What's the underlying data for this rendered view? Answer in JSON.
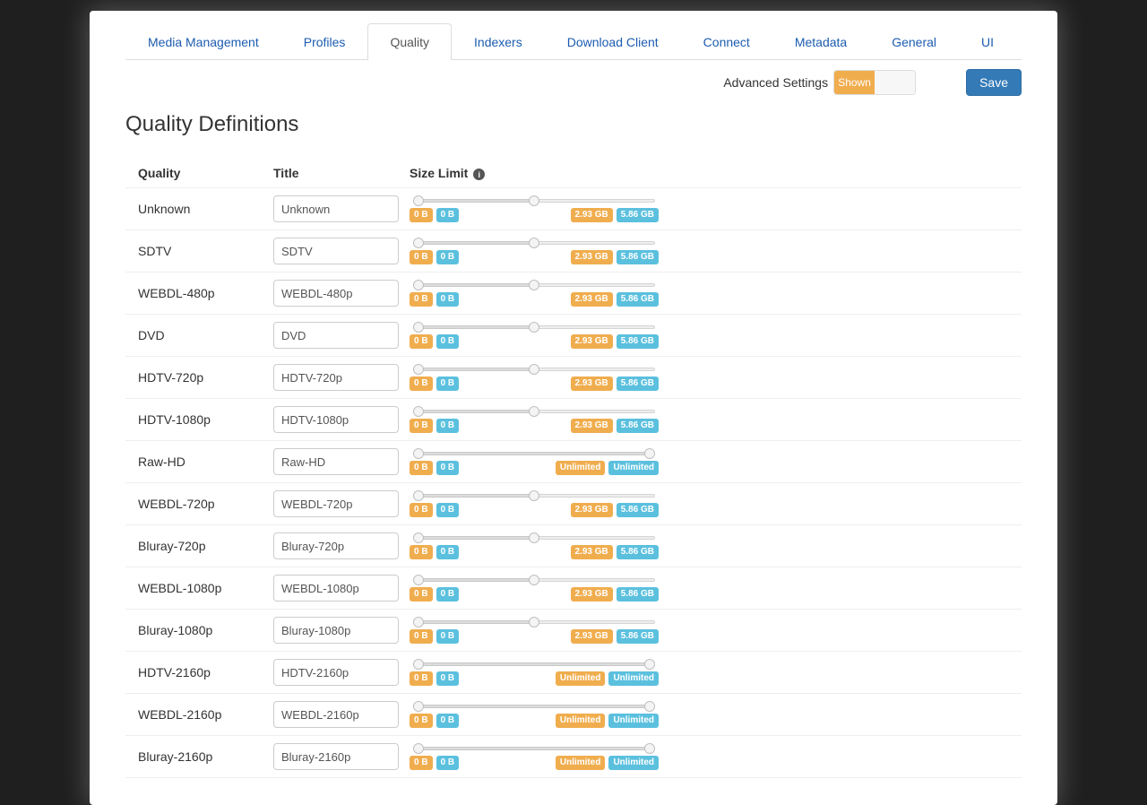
{
  "tabs": [
    {
      "label": "Media Management",
      "active": false
    },
    {
      "label": "Profiles",
      "active": false
    },
    {
      "label": "Quality",
      "active": true
    },
    {
      "label": "Indexers",
      "active": false
    },
    {
      "label": "Download Client",
      "active": false
    },
    {
      "label": "Connect",
      "active": false
    },
    {
      "label": "Metadata",
      "active": false
    },
    {
      "label": "General",
      "active": false
    },
    {
      "label": "UI",
      "active": false
    }
  ],
  "toolbar": {
    "advanced_label": "Advanced Settings",
    "advanced_state": "Shown",
    "save_label": "Save"
  },
  "section_title": "Quality Definitions",
  "columns": {
    "quality": "Quality",
    "title": "Title",
    "size": "Size Limit"
  },
  "rows": [
    {
      "quality": "Unknown",
      "title": "Unknown",
      "min_label": "0 B",
      "min2_label": "0 B",
      "max_label": "2.93 GB",
      "max2_label": "5.86 GB",
      "lo": 0,
      "hi": 0.5
    },
    {
      "quality": "SDTV",
      "title": "SDTV",
      "min_label": "0 B",
      "min2_label": "0 B",
      "max_label": "2.93 GB",
      "max2_label": "5.86 GB",
      "lo": 0,
      "hi": 0.5
    },
    {
      "quality": "WEBDL-480p",
      "title": "WEBDL-480p",
      "min_label": "0 B",
      "min2_label": "0 B",
      "max_label": "2.93 GB",
      "max2_label": "5.86 GB",
      "lo": 0,
      "hi": 0.5
    },
    {
      "quality": "DVD",
      "title": "DVD",
      "min_label": "0 B",
      "min2_label": "0 B",
      "max_label": "2.93 GB",
      "max2_label": "5.86 GB",
      "lo": 0,
      "hi": 0.5
    },
    {
      "quality": "HDTV-720p",
      "title": "HDTV-720p",
      "min_label": "0 B",
      "min2_label": "0 B",
      "max_label": "2.93 GB",
      "max2_label": "5.86 GB",
      "lo": 0,
      "hi": 0.5
    },
    {
      "quality": "HDTV-1080p",
      "title": "HDTV-1080p",
      "min_label": "0 B",
      "min2_label": "0 B",
      "max_label": "2.93 GB",
      "max2_label": "5.86 GB",
      "lo": 0,
      "hi": 0.5
    },
    {
      "quality": "Raw-HD",
      "title": "Raw-HD",
      "min_label": "0 B",
      "min2_label": "0 B",
      "max_label": "Unlimited",
      "max2_label": "Unlimited",
      "lo": 0,
      "hi": 1.0
    },
    {
      "quality": "WEBDL-720p",
      "title": "WEBDL-720p",
      "min_label": "0 B",
      "min2_label": "0 B",
      "max_label": "2.93 GB",
      "max2_label": "5.86 GB",
      "lo": 0,
      "hi": 0.5
    },
    {
      "quality": "Bluray-720p",
      "title": "Bluray-720p",
      "min_label": "0 B",
      "min2_label": "0 B",
      "max_label": "2.93 GB",
      "max2_label": "5.86 GB",
      "lo": 0,
      "hi": 0.5
    },
    {
      "quality": "WEBDL-1080p",
      "title": "WEBDL-1080p",
      "min_label": "0 B",
      "min2_label": "0 B",
      "max_label": "2.93 GB",
      "max2_label": "5.86 GB",
      "lo": 0,
      "hi": 0.5
    },
    {
      "quality": "Bluray-1080p",
      "title": "Bluray-1080p",
      "min_label": "0 B",
      "min2_label": "0 B",
      "max_label": "2.93 GB",
      "max2_label": "5.86 GB",
      "lo": 0,
      "hi": 0.5
    },
    {
      "quality": "HDTV-2160p",
      "title": "HDTV-2160p",
      "min_label": "0 B",
      "min2_label": "0 B",
      "max_label": "Unlimited",
      "max2_label": "Unlimited",
      "lo": 0,
      "hi": 1.0
    },
    {
      "quality": "WEBDL-2160p",
      "title": "WEBDL-2160p",
      "min_label": "0 B",
      "min2_label": "0 B",
      "max_label": "Unlimited",
      "max2_label": "Unlimited",
      "lo": 0,
      "hi": 1.0
    },
    {
      "quality": "Bluray-2160p",
      "title": "Bluray-2160p",
      "min_label": "0 B",
      "min2_label": "0 B",
      "max_label": "Unlimited",
      "max2_label": "Unlimited",
      "lo": 0,
      "hi": 1.0
    }
  ]
}
